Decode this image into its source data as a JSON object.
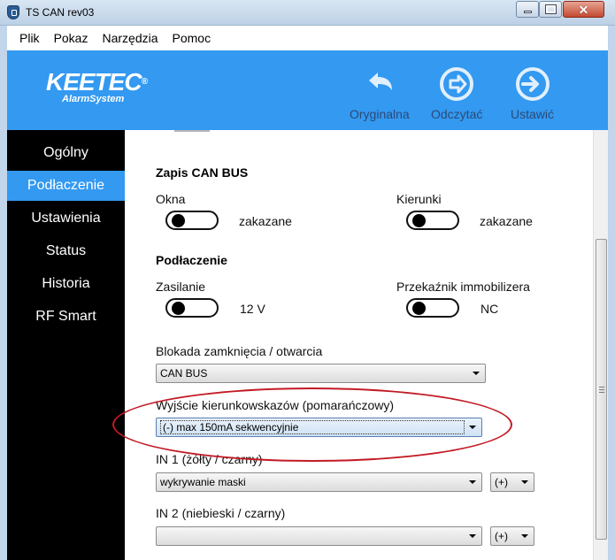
{
  "window": {
    "title": "TS CAN rev03",
    "icon": "app-shield-icon",
    "controls": {
      "minimize": "minimize-icon",
      "maximize": "maximize-icon",
      "close": "close-icon",
      "close_glyph": "✕"
    }
  },
  "menu": [
    "Plik",
    "Pokaz",
    "Narzędzia",
    "Pomoc"
  ],
  "header": {
    "logo": {
      "main": "KEETEC",
      "registered": "®",
      "sub": "AlarmSystem"
    },
    "tools": [
      {
        "label": "Oryginalna",
        "icon": "undo-arrow-icon"
      },
      {
        "label": "Odczytać",
        "icon": "read-arrow-circle-icon"
      },
      {
        "label": "Ustawić",
        "icon": "write-arrow-circle-icon"
      }
    ],
    "colors": {
      "accent": "#3399f1",
      "label": "#2b4a78"
    }
  },
  "sidebar": {
    "items": [
      {
        "label": "Ogólny"
      },
      {
        "label": "Podłaczenie"
      },
      {
        "label": "Ustawienia"
      },
      {
        "label": "Status"
      },
      {
        "label": "Historia"
      },
      {
        "label": "RF Smart"
      }
    ],
    "active": "Podłaczenie"
  },
  "content": {
    "can_bus": {
      "title": "Zapis CAN BUS",
      "okna": {
        "label": "Okna",
        "value": "zakazane",
        "toggle_on": false
      },
      "kierunki": {
        "label": "Kierunki",
        "value": "zakazane",
        "toggle_on": false
      }
    },
    "connection": {
      "title": "Podłaczenie",
      "zasilanie": {
        "label": "Zasilanie",
        "value": "12 V",
        "toggle_on": false
      },
      "immobilizer": {
        "label": "Przekaźnik immobilizera",
        "value": "NC",
        "toggle_on": false
      }
    },
    "blokada": {
      "label": "Blokada zamknięcia / otwarcia",
      "selected": "CAN BUS"
    },
    "wyjscie": {
      "label": "Wyjście kierunkowskazów (pomarańczowy)",
      "selected": "(-) max 150mA sekwencyjnie",
      "highlight_color": "#c21a24"
    },
    "in1": {
      "label": "IN 1 (żółty / czarny)",
      "selected": "wykrywanie maski",
      "polarity": "(+)"
    },
    "in2": {
      "label": "IN 2 (niebieski / czarny)",
      "selected": "",
      "polarity": "(+)"
    }
  }
}
